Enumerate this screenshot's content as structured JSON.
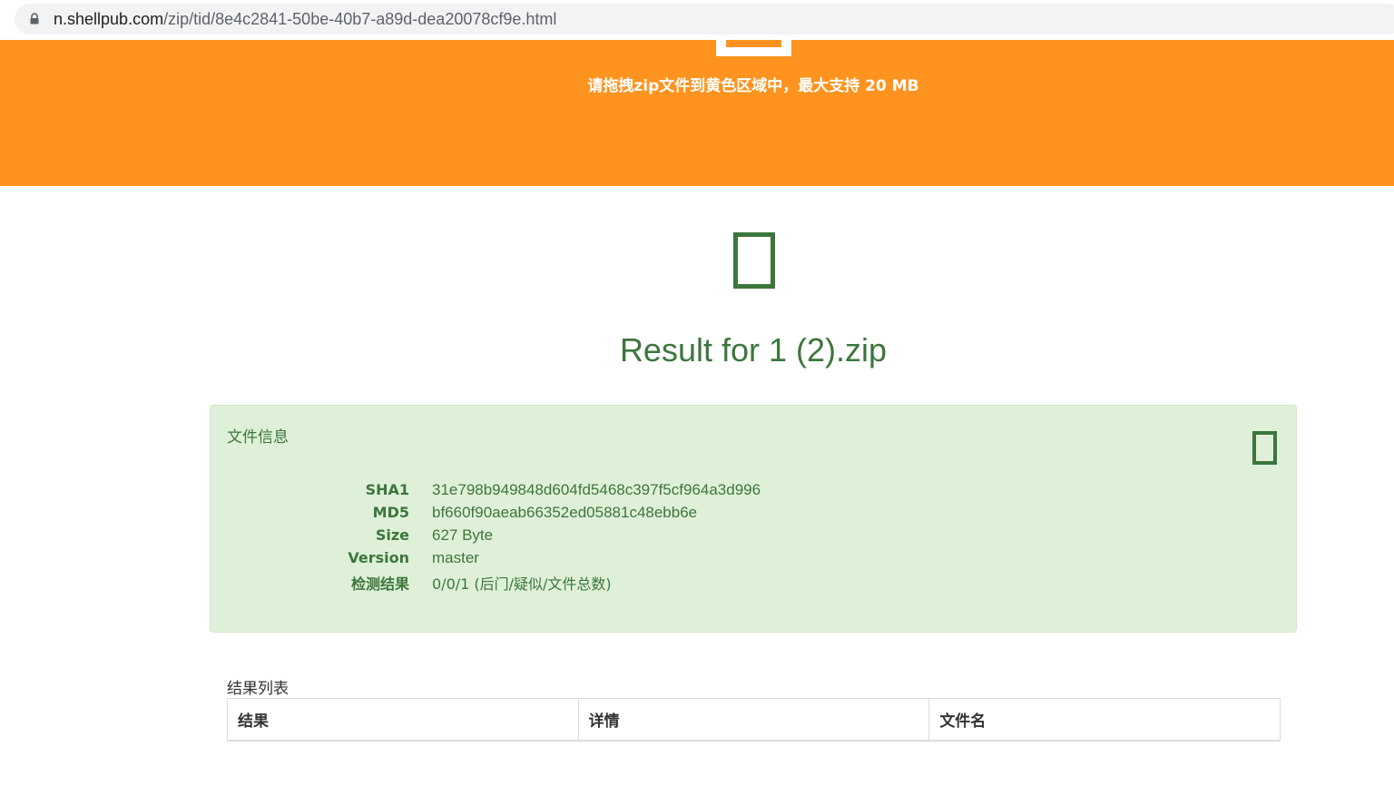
{
  "browser": {
    "url_host": "n.shellpub.com",
    "url_path": "/zip/tid/8e4c2841-50be-40b7-a89d-dea20078cf9e.html"
  },
  "banner": {
    "text": "请拖拽zip文件到黄色区域中，最大支持 20 MB",
    "color": "#fe931f",
    "icon": "upload-icon"
  },
  "result": {
    "title": "Result for 1 (2).zip",
    "icon": "check-icon",
    "color": "#3c763d"
  },
  "file_info": {
    "title": "文件信息",
    "icon": "file-icon",
    "background": "#dff0d8",
    "rows": [
      {
        "label": "SHA1",
        "value": "31e798b949848d604fd5468c397f5cf964a3d996"
      },
      {
        "label": "MD5",
        "value": "bf660f90aeab66352ed05881c48ebb6e"
      },
      {
        "label": "Size",
        "value": "627 Byte"
      },
      {
        "label": "Version",
        "value": "master"
      },
      {
        "label": "检测结果",
        "value": "0/0/1 (后门/疑似/文件总数)"
      }
    ]
  },
  "results_list": {
    "caption": "结果列表",
    "columns": [
      "结果",
      "详情",
      "文件名"
    ]
  }
}
